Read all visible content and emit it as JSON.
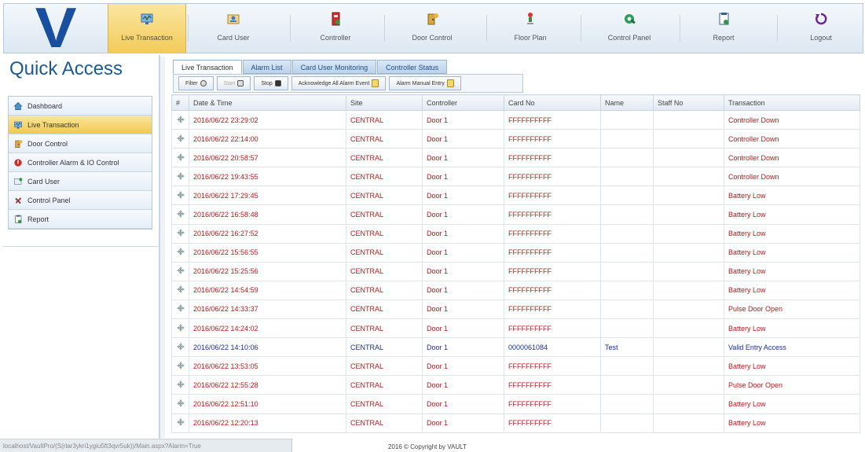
{
  "nav": {
    "logo": "V",
    "items": [
      {
        "label": "Live Transaction",
        "icon": "monitor-icon"
      },
      {
        "label": "Card User",
        "icon": "id-card-icon"
      },
      {
        "label": "Controller",
        "icon": "controller-icon"
      },
      {
        "label": "Door Control",
        "icon": "door-icon"
      },
      {
        "label": "Floor Plan",
        "icon": "floor-plan-icon"
      },
      {
        "label": "Control Panel",
        "icon": "gear-icon"
      },
      {
        "label": "Report",
        "icon": "report-icon"
      },
      {
        "label": "Logout",
        "icon": "logout-icon"
      }
    ],
    "active": "Live Transaction"
  },
  "quick_access": {
    "title": "Quick Access",
    "items": [
      {
        "label": "Dashboard",
        "icon": "home-icon"
      },
      {
        "label": "Live Transaction",
        "icon": "monitor-icon"
      },
      {
        "label": "Door Control",
        "icon": "door-icon"
      },
      {
        "label": "Controller Alarm & IO Control",
        "icon": "alarm-icon"
      },
      {
        "label": "Card User",
        "icon": "card-user-icon"
      },
      {
        "label": "Control Panel",
        "icon": "tools-icon"
      },
      {
        "label": "Report",
        "icon": "report-icon"
      }
    ],
    "active": "Live Transaction"
  },
  "tabs": [
    "Live Transaction",
    "Alarm List",
    "Card User Monitoring",
    "Controller Status"
  ],
  "toolbar": {
    "filter": "Filter",
    "start": "Start",
    "stop": "Stop",
    "ack_all": "Acknowledge All Alarm Event",
    "manual_entry": "Alarm Manual Entry"
  },
  "table": {
    "headers": [
      "#",
      "Date & Time",
      "Site",
      "Controller",
      "Card No",
      "Name",
      "Staff No",
      "Transaction"
    ],
    "rows": [
      {
        "datetime": "2016/06/22 23:29:02",
        "site": "CENTRAL",
        "controller": "Door 1",
        "card": "FFFFFFFFFF",
        "name": "",
        "staff": "",
        "transaction": "Controller Down",
        "type": "alarm"
      },
      {
        "datetime": "2016/06/22 22:14:00",
        "site": "CENTRAL",
        "controller": "Door 1",
        "card": "FFFFFFFFFF",
        "name": "",
        "staff": "",
        "transaction": "Controller Down",
        "type": "alarm"
      },
      {
        "datetime": "2016/06/22 20:58:57",
        "site": "CENTRAL",
        "controller": "Door 1",
        "card": "FFFFFFFFFF",
        "name": "",
        "staff": "",
        "transaction": "Controller Down",
        "type": "alarm"
      },
      {
        "datetime": "2016/06/22 19:43:55",
        "site": "CENTRAL",
        "controller": "Door 1",
        "card": "FFFFFFFFFF",
        "name": "",
        "staff": "",
        "transaction": "Controller Down",
        "type": "alarm"
      },
      {
        "datetime": "2016/06/22 17:29:45",
        "site": "CENTRAL",
        "controller": "Door 1",
        "card": "FFFFFFFFFF",
        "name": "",
        "staff": "",
        "transaction": "Battery Low",
        "type": "alarm"
      },
      {
        "datetime": "2016/06/22 16:58:48",
        "site": "CENTRAL",
        "controller": "Door 1",
        "card": "FFFFFFFFFF",
        "name": "",
        "staff": "",
        "transaction": "Battery Low",
        "type": "alarm"
      },
      {
        "datetime": "2016/06/22 16:27:52",
        "site": "CENTRAL",
        "controller": "Door 1",
        "card": "FFFFFFFFFF",
        "name": "",
        "staff": "",
        "transaction": "Battery Low",
        "type": "alarm"
      },
      {
        "datetime": "2016/06/22 15:56:55",
        "site": "CENTRAL",
        "controller": "Door 1",
        "card": "FFFFFFFFFF",
        "name": "",
        "staff": "",
        "transaction": "Battery Low",
        "type": "alarm"
      },
      {
        "datetime": "2016/06/22 15:25:56",
        "site": "CENTRAL",
        "controller": "Door 1",
        "card": "FFFFFFFFFF",
        "name": "",
        "staff": "",
        "transaction": "Battery Low",
        "type": "alarm"
      },
      {
        "datetime": "2016/06/22 14:54:59",
        "site": "CENTRAL",
        "controller": "Door 1",
        "card": "FFFFFFFFFF",
        "name": "",
        "staff": "",
        "transaction": "Battery Low",
        "type": "alarm"
      },
      {
        "datetime": "2016/06/22 14:33:37",
        "site": "CENTRAL",
        "controller": "Door 1",
        "card": "FFFFFFFFFF",
        "name": "",
        "staff": "",
        "transaction": "Pulse Door Open",
        "type": "alarm"
      },
      {
        "datetime": "2016/06/22 14:24:02",
        "site": "CENTRAL",
        "controller": "Door 1",
        "card": "FFFFFFFFFF",
        "name": "",
        "staff": "",
        "transaction": "Battery Low",
        "type": "alarm"
      },
      {
        "datetime": "2016/06/22 14:10:06",
        "site": "CENTRAL",
        "controller": "Door 1",
        "card": "0000061084",
        "name": "Test",
        "staff": "",
        "transaction": "Valid Entry Access",
        "type": "normal"
      },
      {
        "datetime": "2016/06/22 13:53:05",
        "site": "CENTRAL",
        "controller": "Door 1",
        "card": "FFFFFFFFFF",
        "name": "",
        "staff": "",
        "transaction": "Battery Low",
        "type": "alarm"
      },
      {
        "datetime": "2016/06/22 12:55:28",
        "site": "CENTRAL",
        "controller": "Door 1",
        "card": "FFFFFFFFFF",
        "name": "",
        "staff": "",
        "transaction": "Pulse Door Open",
        "type": "alarm"
      },
      {
        "datetime": "2016/06/22 12:51:10",
        "site": "CENTRAL",
        "controller": "Door 1",
        "card": "FFFFFFFFFF",
        "name": "",
        "staff": "",
        "transaction": "Battery Low",
        "type": "alarm"
      },
      {
        "datetime": "2016/06/22 12:20:13",
        "site": "CENTRAL",
        "controller": "Door 1",
        "card": "FFFFFFFFFF",
        "name": "",
        "staff": "",
        "transaction": "Battery Low",
        "type": "alarm"
      }
    ]
  },
  "status_bar": {
    "url": "localhost/VaultPro/(S(rlar3ykri1ygiu5ft3qvr5uk))/Main.aspx?Alarm=True",
    "copyright": "2016 © Copyright by VAULT"
  },
  "colors": {
    "alarm": "#b31b1b",
    "normal": "#1d2f8f",
    "active": "#f3cb5a",
    "brand": "#1a4fa0"
  }
}
